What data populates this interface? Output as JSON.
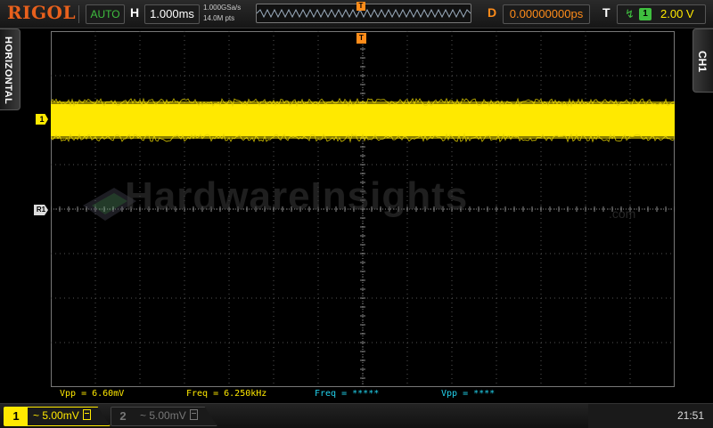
{
  "header": {
    "brand": "RIGOL",
    "run_mode": "AUTO",
    "horizontal_label": "H",
    "timebase": "1.000ms",
    "sample_rate": "1.000GSa/s",
    "memory_depth": "14.0M pts",
    "delay_label": "D",
    "delay_value": "0.00000000ps",
    "trigger_label": "T",
    "trigger_source": "1",
    "trigger_level": "2.00 V"
  },
  "side_tabs": {
    "left": "HORIZONTAL",
    "right": "CH1"
  },
  "markers": {
    "ch1": "1",
    "ref": "R1",
    "trigger": "T"
  },
  "watermark": {
    "text": "HardwareInsights",
    "suffix": ".com"
  },
  "measurements": [
    {
      "text": "Vpp = 6.60mV",
      "color": "#ffe900"
    },
    {
      "text": "Freq = 6.250kHz",
      "color": "#ffe900"
    },
    {
      "text": "Freq = *****",
      "color": "#22d3ee"
    },
    {
      "text": "Vpp = ****",
      "color": "#22d3ee"
    }
  ],
  "channels": [
    {
      "number": "1",
      "coupling": "~",
      "scale": "5.00mV",
      "active": true
    },
    {
      "number": "2",
      "coupling": "~",
      "scale": "5.00mV",
      "active": false
    }
  ],
  "clock": "21:51",
  "colors": {
    "ch1": "#ffe900",
    "trigger": "#ff8c1a",
    "accent_green": "#3fbf3f",
    "grid": "#555555"
  }
}
